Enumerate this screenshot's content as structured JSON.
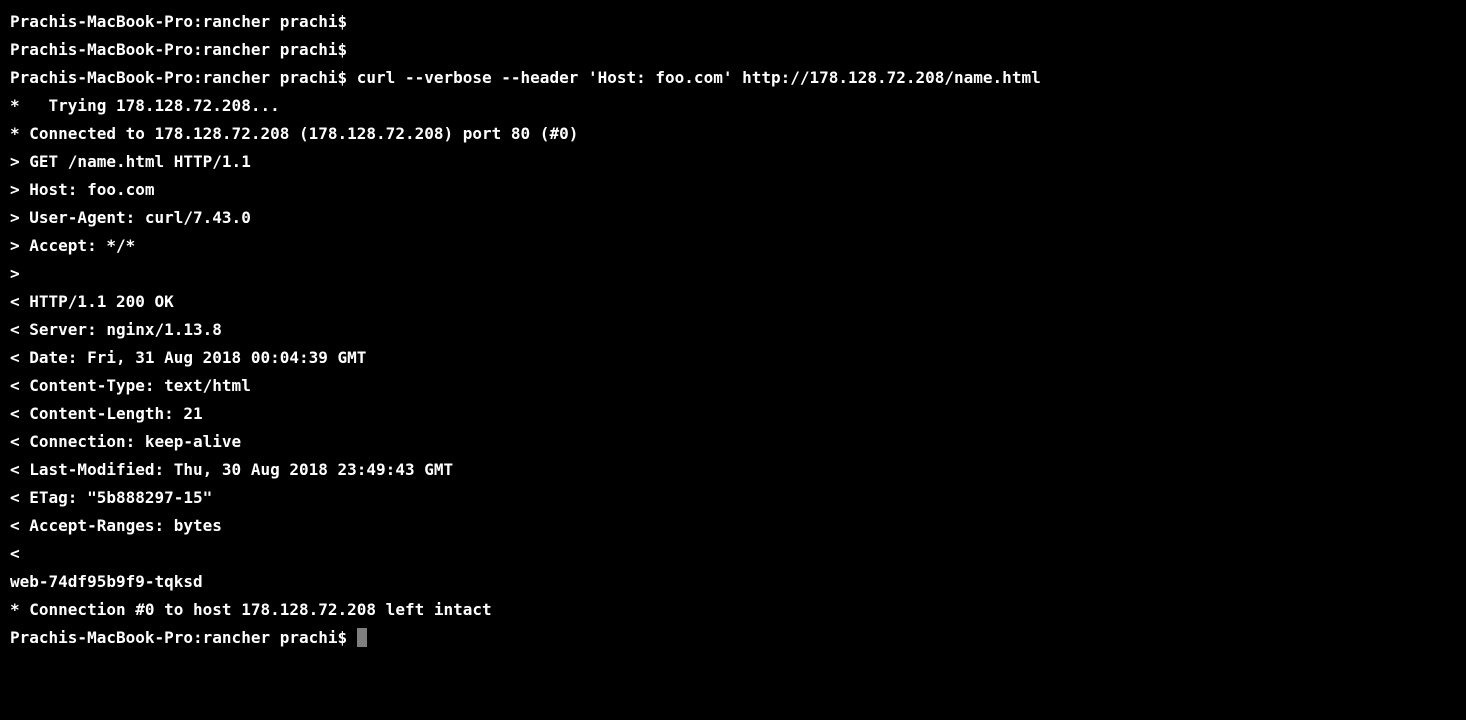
{
  "terminal": {
    "lines": [
      {
        "type": "prompt",
        "text": "Prachis-MacBook-Pro:rancher prachi$"
      },
      {
        "type": "prompt",
        "text": "Prachis-MacBook-Pro:rancher prachi$"
      },
      {
        "type": "prompt_cmd",
        "prompt": "Prachis-MacBook-Pro:rancher prachi$ ",
        "command": "curl --verbose --header 'Host: foo.com' http://178.128.72.208/name.html"
      },
      {
        "type": "output",
        "text": "*   Trying 178.128.72.208..."
      },
      {
        "type": "output",
        "text": "* Connected to 178.128.72.208 (178.128.72.208) port 80 (#0)"
      },
      {
        "type": "output",
        "text": "> GET /name.html HTTP/1.1"
      },
      {
        "type": "output",
        "text": "> Host: foo.com"
      },
      {
        "type": "output",
        "text": "> User-Agent: curl/7.43.0"
      },
      {
        "type": "output",
        "text": "> Accept: */*"
      },
      {
        "type": "output",
        "text": ">"
      },
      {
        "type": "output",
        "text": "< HTTP/1.1 200 OK"
      },
      {
        "type": "output",
        "text": "< Server: nginx/1.13.8"
      },
      {
        "type": "output",
        "text": "< Date: Fri, 31 Aug 2018 00:04:39 GMT"
      },
      {
        "type": "output",
        "text": "< Content-Type: text/html"
      },
      {
        "type": "output",
        "text": "< Content-Length: 21"
      },
      {
        "type": "output",
        "text": "< Connection: keep-alive"
      },
      {
        "type": "output",
        "text": "< Last-Modified: Thu, 30 Aug 2018 23:49:43 GMT"
      },
      {
        "type": "output",
        "text": "< ETag: \"5b888297-15\""
      },
      {
        "type": "output",
        "text": "< Accept-Ranges: bytes"
      },
      {
        "type": "output",
        "text": "<"
      },
      {
        "type": "output",
        "text": "web-74df95b9f9-tqksd"
      },
      {
        "type": "output",
        "text": "* Connection #0 to host 178.128.72.208 left intact"
      },
      {
        "type": "prompt_cursor",
        "text": "Prachis-MacBook-Pro:rancher prachi$ "
      }
    ]
  }
}
